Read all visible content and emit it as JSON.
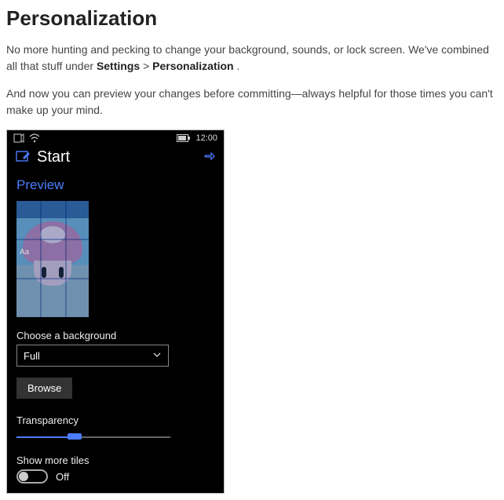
{
  "article": {
    "title": "Personalization",
    "p1_a": "No more hunting and pecking to change your background, sounds, or lock screen. We've combined all that stuff under ",
    "p1_b1": "Settings",
    "p1_sep": " > ",
    "p1_b2": "Personalization",
    "p1_c": ".",
    "p2": "And now you can preview your changes before committing—always helpful for those times you can't make up your mind."
  },
  "phone": {
    "status": {
      "time": "12:00"
    },
    "titlebar": {
      "title": "Start"
    },
    "preview_label": "Preview",
    "preview_sample_text": "Aa",
    "choose_bg_label": "Choose a background",
    "choose_bg_value": "Full",
    "browse_label": "Browse",
    "transparency_label": "Transparency",
    "transparency_percent": 38,
    "show_more_label": "Show more tiles",
    "show_more_state": "Off"
  }
}
